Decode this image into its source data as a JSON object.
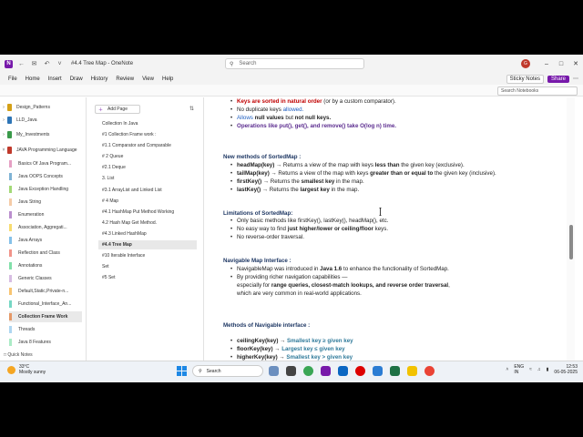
{
  "window": {
    "title": "#4.4 Tree Map  -  OneNote",
    "search_placeholder": "Search"
  },
  "menu": [
    "File",
    "Home",
    "Insert",
    "Draw",
    "History",
    "Review",
    "View",
    "Help"
  ],
  "topright": {
    "sticky": "Sticky Notes",
    "share": "Share",
    "avatar": "G"
  },
  "notebook_search": "Search Notebooks",
  "notebooks": [
    {
      "label": "Design_Patterns",
      "color": "#d4a017"
    },
    {
      "label": "LLD_Java",
      "color": "#2e75b6"
    },
    {
      "label": "My_Investments",
      "color": "#3a9a4a"
    },
    {
      "label": "JAVA Programming Language",
      "color": "#c0392b"
    }
  ],
  "sections": [
    {
      "label": "Basics Of Java Program...",
      "color": "#e6a0c4"
    },
    {
      "label": "Java OOPS Concepts",
      "color": "#7fb3d5"
    },
    {
      "label": "Java Exception Handling",
      "color": "#a3d977"
    },
    {
      "label": "Java String",
      "color": "#f5cba7"
    },
    {
      "label": "Enumeration",
      "color": "#bb8fce"
    },
    {
      "label": "Association, Aggregati...",
      "color": "#f7dc6f"
    },
    {
      "label": "Java Arrays",
      "color": "#85c1e9"
    },
    {
      "label": "Reflection and Class",
      "color": "#f1948a"
    },
    {
      "label": "Annotations",
      "color": "#82e0aa"
    },
    {
      "label": "Generic Classes",
      "color": "#d7bde2"
    },
    {
      "label": "Default,Static,Private-n...",
      "color": "#f8c471"
    },
    {
      "label": "Functional_Interface_An...",
      "color": "#76d7c4"
    },
    {
      "label": "Collection Frame Work",
      "color": "#e59866"
    },
    {
      "label": "Threads",
      "color": "#aed6f1"
    },
    {
      "label": "Java 8 Features",
      "color": "#abebc6"
    }
  ],
  "quick_notes": "Quick Notes",
  "add_page": "Add Page",
  "pages": [
    "Collection In Java",
    "#1 Collection Frame work :",
    "#1.1 Comparator and Comparable",
    "# 2 Queue",
    "#2.1 Deque",
    "3. List",
    "#3.1 ArrayList and Linked List",
    "# 4 Map",
    "#4.1 HashMap Put Method Working",
    "4.2 Hash Map Get Method.",
    "#4.3 Linked HashMap",
    "#4.4 Tree Map",
    "#10 Iterable  Interface",
    "Set",
    "#5 Set"
  ],
  "active_page_index": 11,
  "content": {
    "top_lines": [
      {
        "a": "Keys are sorted in natural order",
        "b": " (or by a custom comparator)."
      },
      {
        "a": "No duplicate keys ",
        "b": "allowed."
      },
      {
        "a": "Allows ",
        "b": "null values",
        "c": " but ",
        "d": "not null keys."
      },
      {
        "a": "Operations like put(), get(), and remove() take O(log n) time."
      }
    ],
    "h_sortedmap": "New methods of SortedMap :",
    "sortedmap_methods": [
      {
        "name": "headMap(key)",
        "pre": " → Returns a view of the map with keys ",
        "em": "less than",
        "post": " the given key (exclusive)."
      },
      {
        "name": "tailMap(key)",
        "pre": " → Returns a view of the map with keys ",
        "em": "greater than or equal to",
        "post": " the given key (inclusive)."
      },
      {
        "name": "firstKey()",
        "pre": " → Returns the ",
        "em": "smallest key",
        "post": " in the map."
      },
      {
        "name": "lastKey()",
        "pre": " → Returns the ",
        "em": "largest key",
        "post": " in the map."
      }
    ],
    "h_limitations": "Limitations of SortedMap:",
    "limitations": [
      {
        "pre": "Only basic methods like firstKey(), lastKey(), headMap(), etc.",
        "em": "",
        "post": ""
      },
      {
        "pre": "No easy way to find ",
        "em": "just higher/lower or ceiling/floor",
        "post": " keys."
      },
      {
        "pre": "No reverse-order traversal.",
        "em": "",
        "post": ""
      }
    ],
    "h_navigable": "Navigable Map Interface  :",
    "navigable_lines": [
      {
        "pre": "NavigableMap was introduced in ",
        "em": "Java 1.6",
        "post": " to enhance the functionality of SortedMap."
      },
      {
        "pre": "By providing richer navigation capabilities —",
        "em": "",
        "post": ""
      },
      {
        "pre": "especially for ",
        "em": "range queries, closest-match lookups, and reverse order traversal",
        "post": ","
      },
      {
        "pre": "which are very common in real-world applications.",
        "em": "",
        "post": ""
      }
    ],
    "h_methods_nav": "Methods of Navigable interface :",
    "nav_methods": [
      {
        "name": "ceilingKey(key)",
        "arrow": " → ",
        "desc": "Smallest key ≥ given key"
      },
      {
        "name": "floorKey(key)",
        "arrow": " → ",
        "desc": "Largest key ≤ given key"
      },
      {
        "name": "higherKey(key)",
        "arrow": " → ",
        "desc": "Smallest key > given key"
      }
    ]
  },
  "taskbar": {
    "temp": "33°C",
    "weather": "Mostly sunny",
    "search": "Search",
    "lang1": "ENG",
    "lang2": "IN",
    "time": "12:53",
    "date": "06-05-2025"
  }
}
